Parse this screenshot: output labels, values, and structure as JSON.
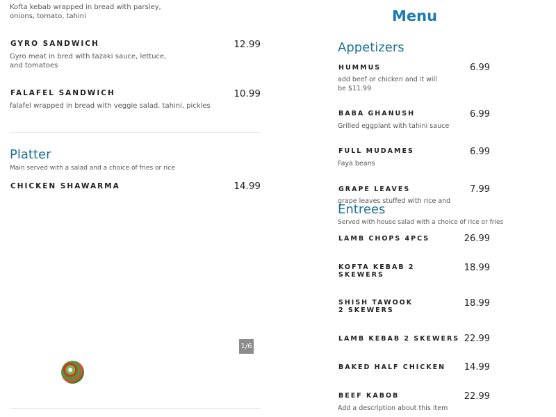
{
  "left": {
    "top_desc": "Kofta kebab wrapped in bread with parsley, onions, tomato, tahini",
    "items": [
      {
        "name": "Gyro Sandwich",
        "price": "12.99",
        "desc": "Gyro meat in bred with tazaki sauce, lettuce, and tomatoes"
      },
      {
        "name": "Falafel Sandwich",
        "price": "10.99",
        "desc": "falafel wrapped in bread with veggie salad, tahini, pickles"
      }
    ],
    "platter": {
      "title": "Platter",
      "subtitle": "Main served with a salad and a choice of fries or rice",
      "items": [
        {
          "name": "Chicken Shawarma",
          "price": "14.99"
        }
      ]
    },
    "gallery_counter": "1/6"
  },
  "right": {
    "menu_title": "Menu",
    "appetizers": {
      "title": "Appetizers",
      "items": [
        {
          "name": "Hummus",
          "price": "6.99",
          "desc": "add beef or chicken and it will be $11.99"
        },
        {
          "name": "Baba Ghanush",
          "price": "6.99",
          "desc": "Grilled eggplant with tahini sauce"
        },
        {
          "name": "Full Mudames",
          "price": "6.99",
          "desc": "Faya beans"
        },
        {
          "name": "Grape Leaves",
          "price": "7.99",
          "desc": "grape leaves stuffed with rice and"
        }
      ]
    },
    "entrees": {
      "title": "Entrees",
      "subtitle": "Served with house salad with a choice of rice or fries",
      "items": [
        {
          "name": "Lamb Chops 4pcs",
          "price": "26.99"
        },
        {
          "name": "Kofta Kebab 2 Skewers",
          "price": "18.99"
        },
        {
          "name": "Shish Tawook 2 Skewers",
          "price": "18.99"
        },
        {
          "name": "Lamb Kebab 2 Skewers",
          "price": "22.99"
        },
        {
          "name": "Baked Half Chicken",
          "price": "14.99"
        },
        {
          "name": "Beef Kabob",
          "price": "22.99",
          "desc": "Add a description about this item"
        }
      ]
    }
  },
  "colors": {
    "accent": "#1b7ab1",
    "section": "#1d6f98"
  },
  "icons": {
    "dish_image": "food-plate-image"
  }
}
